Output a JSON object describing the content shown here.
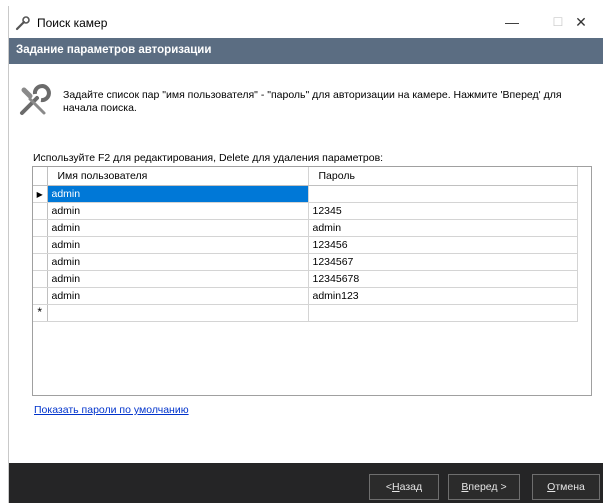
{
  "window": {
    "title": "Поиск камер",
    "minimize": "—",
    "maximize": "☐",
    "close": "✕"
  },
  "header": {
    "title": "Задание параметров авторизации"
  },
  "instructions": "Задайте список пар \"имя пользователя\" - \"пароль\" для авторизации на камере. Нажмите 'Вперед' для начала поиска.",
  "hint": "Используйте F2 для редактирования, Delete для удаления параметров:",
  "grid": {
    "columns": [
      "Имя пользователя",
      "Пароль"
    ],
    "rows": [
      [
        "admin",
        ""
      ],
      [
        "admin",
        "12345"
      ],
      [
        "admin",
        "admin"
      ],
      [
        "admin",
        "123456"
      ],
      [
        "admin",
        "1234567"
      ],
      [
        "admin",
        "12345678"
      ],
      [
        "admin",
        "admin123"
      ]
    ],
    "new_row_marker": "*",
    "current_row_marker": "▶"
  },
  "link": "Показать пароли по умолчанию",
  "footer": {
    "back": {
      "prefix": "< ",
      "key": "Н",
      "rest": "азад"
    },
    "next": {
      "prefix": "",
      "key": "В",
      "rest": "перед >"
    },
    "cancel": {
      "prefix": "",
      "key": "О",
      "rest": "тмена"
    }
  },
  "colors": {
    "header": "#5b6d82",
    "footer": "#252526",
    "selection": "#0078d7",
    "link": "#0033cc"
  }
}
